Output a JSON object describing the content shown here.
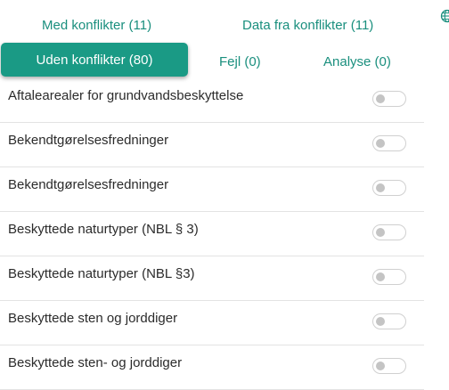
{
  "tabs": {
    "top": [
      {
        "label": "Med konflikter (11)"
      },
      {
        "label": "Data fra konflikter (11)"
      }
    ],
    "bottom": [
      {
        "label": "Uden konflikter (80)",
        "active": true
      },
      {
        "label": "Fejl (0)"
      },
      {
        "label": "Analyse (0)"
      }
    ]
  },
  "colors": {
    "accent": "#1a9a85",
    "tab_text": "#1a8f7e",
    "toggle_off_knob": "#c4c4c4"
  },
  "icons": {
    "language": "globe-icon"
  },
  "items": [
    {
      "label": "Aftalearealer for grundvandsbeskyttelse",
      "enabled": false
    },
    {
      "label": "Bekendtgørelsesfredninger",
      "enabled": false
    },
    {
      "label": "Bekendtgørelsesfredninger",
      "enabled": false
    },
    {
      "label": "Beskyttede naturtyper (NBL § 3)",
      "enabled": false
    },
    {
      "label": "Beskyttede naturtyper (NBL §3)",
      "enabled": false
    },
    {
      "label": "Beskyttede sten og jorddiger",
      "enabled": false
    },
    {
      "label": "Beskyttede sten- og jorddiger",
      "enabled": false
    }
  ]
}
